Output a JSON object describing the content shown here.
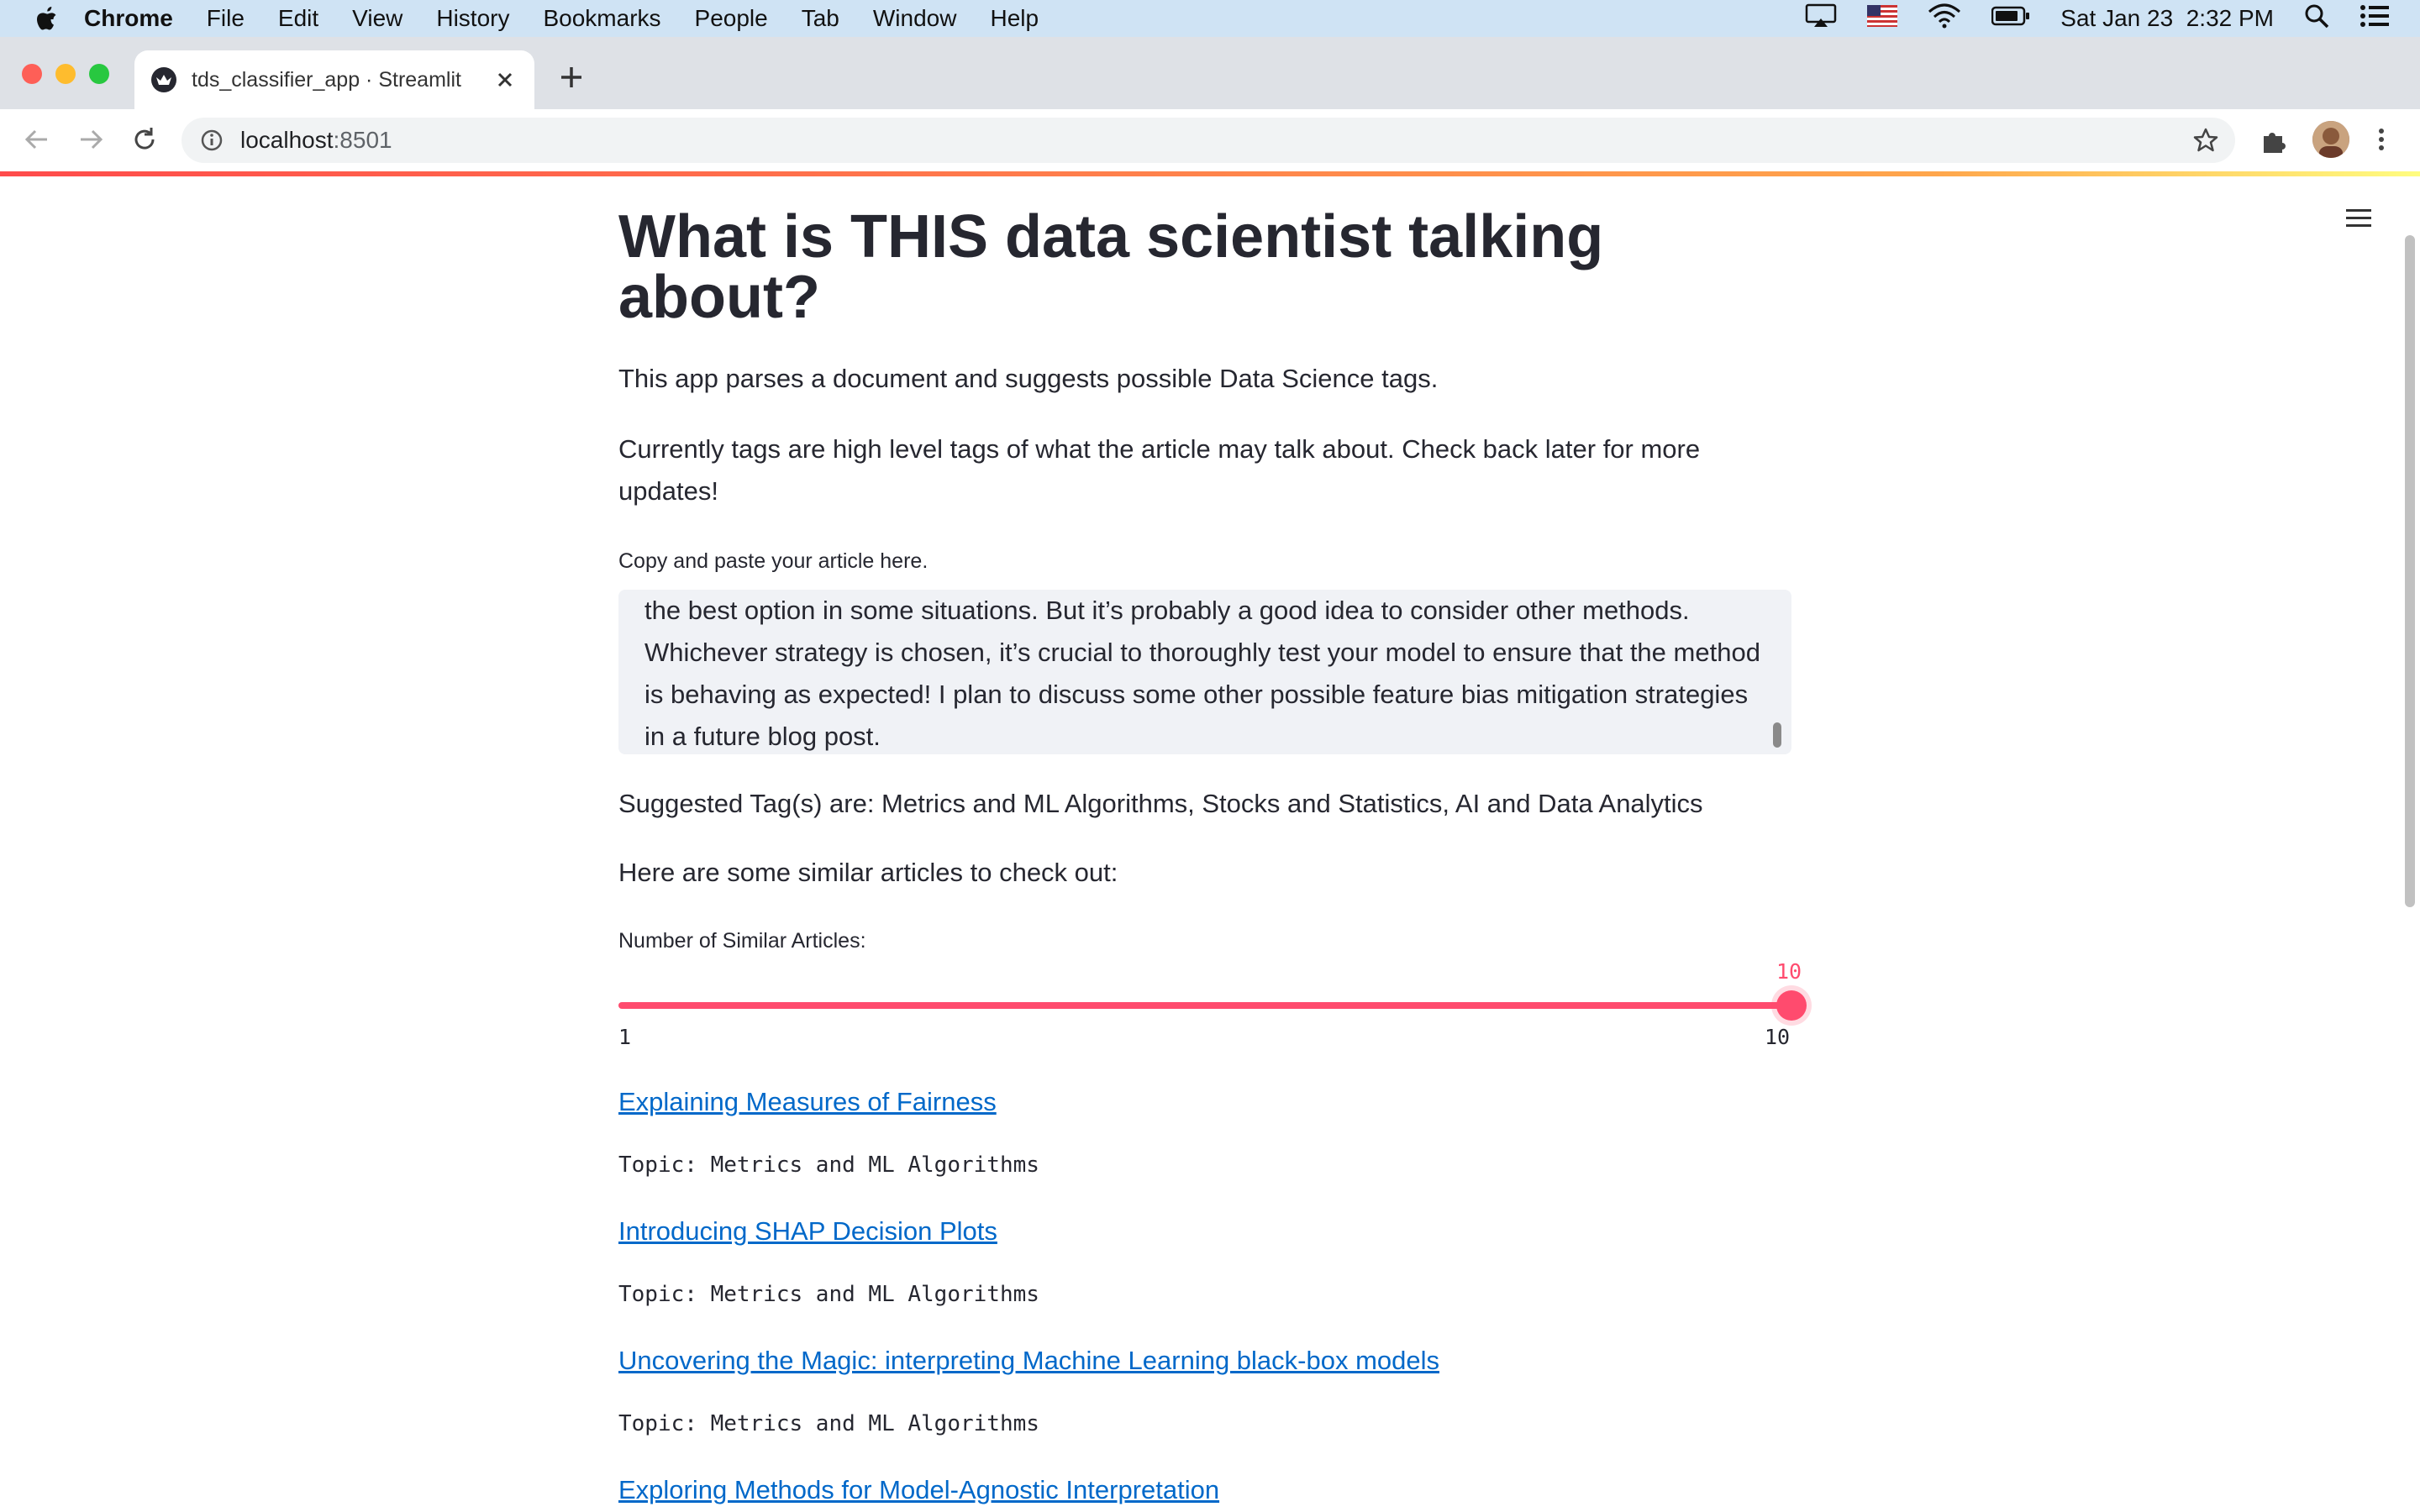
{
  "menubar": {
    "app_name": "Chrome",
    "menus": [
      "File",
      "Edit",
      "View",
      "History",
      "Bookmarks",
      "People",
      "Tab",
      "Window",
      "Help"
    ],
    "datetime": "Sat Jan 23  2:32 PM"
  },
  "browser": {
    "tab_title": "tds_classifier_app · Streamlit",
    "url_host": "localhost",
    "url_port": ":8501"
  },
  "page": {
    "title": "What is THIS data scientist talking about?",
    "intro": "This app parses a document and suggests possible Data Science tags.",
    "note": "Currently tags are high level tags of what the article may talk about. Check back later for more updates!",
    "textarea_label": "Copy and paste your article here.",
    "textarea_value": "the best option in some situations. But it’s probably a good idea to consider other methods. Whichever strategy is chosen, it’s crucial to thoroughly test your model to ensure that the method is behaving as expected! I plan to discuss some other possible feature bias mitigation strategies in a future blog post.",
    "suggested_tags": "Suggested Tag(s) are: Metrics and ML Algorithms, Stocks and Statistics, AI and Data Analytics",
    "similar_heading": "Here are some similar articles to check out:",
    "slider_label": "Number of Similar Articles:",
    "slider": {
      "value": "10",
      "min": "1",
      "max": "10",
      "fraction": 1.0
    },
    "articles": [
      {
        "title": "Explaining Measures of Fairness",
        "topic": "Topic: Metrics and ML Algorithms"
      },
      {
        "title": "Introducing SHAP Decision Plots",
        "topic": "Topic: Metrics and ML Algorithms"
      },
      {
        "title": "Uncovering the Magic: interpreting Machine Learning black-box models",
        "topic": "Topic: Metrics and ML Algorithms"
      },
      {
        "title": "Exploring Methods for Model-Agnostic Interpretation",
        "topic": ""
      }
    ]
  },
  "colors": {
    "accent": "#ff4b6e",
    "link": "#0068c9",
    "text": "#262730"
  }
}
